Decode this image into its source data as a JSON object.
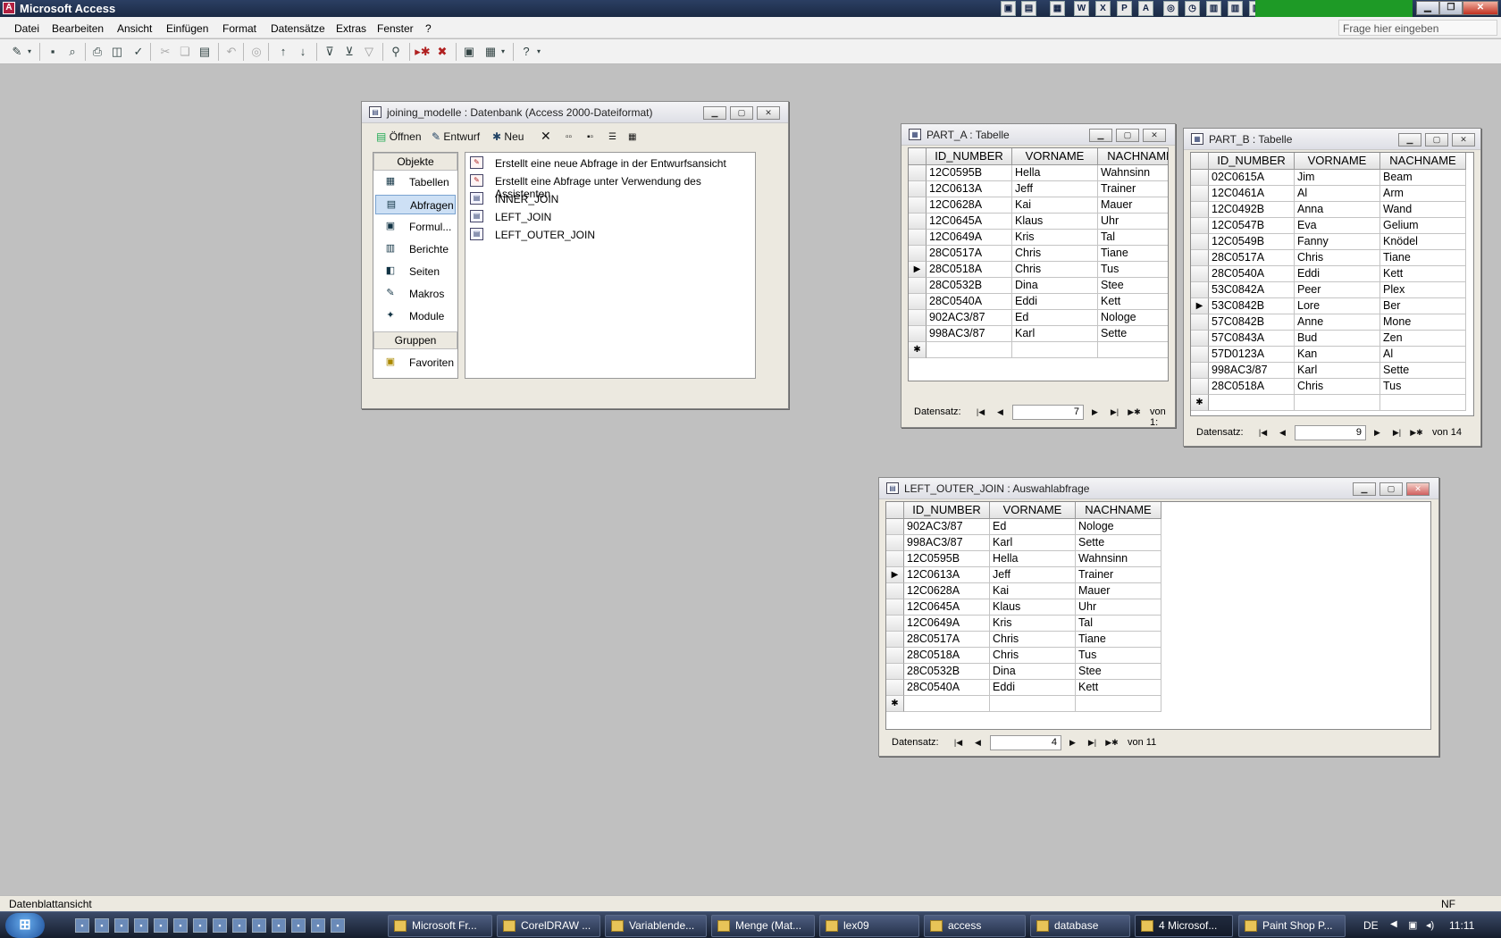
{
  "app": {
    "title": "Microsoft Access"
  },
  "quick_icons": [
    "app-icon",
    "notepad-icon",
    "excel-icon",
    "word-icon",
    "excel-icon",
    "powerpoint-icon",
    "acrobat-icon",
    "network-icon",
    "clock-icon",
    "folder-icon",
    "folder-icon",
    "folder-icon"
  ],
  "menu": {
    "items": [
      "Datei",
      "Bearbeiten",
      "Ansicht",
      "Einfügen",
      "Format",
      "Datensätze",
      "Extras",
      "Fenster",
      "?"
    ],
    "help_box": "Frage hier eingeben"
  },
  "db_window": {
    "title": "joining_modelle : Datenbank (Access 2000-Dateiformat)",
    "toolbar": {
      "open": "Öffnen",
      "design": "Entwurf",
      "new": "Neu"
    },
    "objects_header": "Objekte",
    "objects": [
      {
        "label": "Tabellen",
        "icon": "table-icon",
        "glyph": "▦"
      },
      {
        "label": "Abfragen",
        "icon": "query-icon",
        "glyph": "▤"
      },
      {
        "label": "Formul...",
        "icon": "form-icon",
        "glyph": "▣"
      },
      {
        "label": "Berichte",
        "icon": "report-icon",
        "glyph": "▥"
      },
      {
        "label": "Seiten",
        "icon": "page-icon",
        "glyph": "◧"
      },
      {
        "label": "Makros",
        "icon": "macro-icon",
        "glyph": "✎"
      },
      {
        "label": "Module",
        "icon": "module-icon",
        "glyph": "✦"
      }
    ],
    "groups_header": "Gruppen",
    "favorites": "Favoriten",
    "list": [
      "Erstellt eine neue Abfrage in der Entwurfsansicht",
      "Erstellt eine Abfrage unter Verwendung des Assistenten",
      "INNER_JOIN",
      "LEFT_JOIN",
      "LEFT_OUTER_JOIN"
    ]
  },
  "part_a": {
    "title": "PART_A : Tabelle",
    "columns": [
      "ID_NUMBER",
      "VORNAME",
      "NACHNAME"
    ],
    "rows": [
      [
        "12C0595B",
        "Hella",
        "Wahnsinn"
      ],
      [
        "12C0613A",
        "Jeff",
        "Trainer"
      ],
      [
        "12C0628A",
        "Kai",
        "Mauer"
      ],
      [
        "12C0645A",
        "Klaus",
        "Uhr"
      ],
      [
        "12C0649A",
        "Kris",
        "Tal"
      ],
      [
        "28C0517A",
        "Chris",
        "Tiane"
      ],
      [
        "28C0518A",
        "Chris",
        "Tus"
      ],
      [
        "28C0532B",
        "Dina",
        "Stee"
      ],
      [
        "28C0540A",
        "Eddi",
        "Kett"
      ],
      [
        "902AC3/87",
        "Ed",
        "Nologe"
      ],
      [
        "998AC3/87",
        "Karl",
        "Sette"
      ]
    ],
    "current_row": 6,
    "nav": {
      "label": "Datensatz:",
      "record": "7",
      "of": "von 1:"
    }
  },
  "part_b": {
    "title": "PART_B : Tabelle",
    "columns": [
      "ID_NUMBER",
      "VORNAME",
      "NACHNAME"
    ],
    "rows": [
      [
        "02C0615A",
        "Jim",
        "Beam"
      ],
      [
        "12C0461A",
        "Al",
        "Arm"
      ],
      [
        "12C0492B",
        "Anna",
        "Wand"
      ],
      [
        "12C0547B",
        "Eva",
        "Gelium"
      ],
      [
        "12C0549B",
        "Fanny",
        "Knödel"
      ],
      [
        "28C0517A",
        "Chris",
        "Tiane"
      ],
      [
        "28C0540A",
        "Eddi",
        "Kett"
      ],
      [
        "53C0842A",
        "Peer",
        "Plex"
      ],
      [
        "53C0842B",
        "Lore",
        "Ber"
      ],
      [
        "57C0842B",
        "Anne",
        "Mone"
      ],
      [
        "57C0843A",
        "Bud",
        "Zen"
      ],
      [
        "57D0123A",
        "Kan",
        "Al"
      ],
      [
        "998AC3/87",
        "Karl",
        "Sette"
      ],
      [
        "28C0518A",
        "Chris",
        "Tus"
      ]
    ],
    "current_row": 8,
    "nav": {
      "label": "Datensatz:",
      "record": "9",
      "of": "von 14"
    }
  },
  "query": {
    "title": "LEFT_OUTER_JOIN : Auswahlabfrage",
    "columns": [
      "ID_NUMBER",
      "VORNAME",
      "NACHNAME"
    ],
    "rows": [
      [
        "902AC3/87",
        "Ed",
        "Nologe"
      ],
      [
        "998AC3/87",
        "Karl",
        "Sette"
      ],
      [
        "12C0595B",
        "Hella",
        "Wahnsinn"
      ],
      [
        "12C0613A",
        "Jeff",
        "Trainer"
      ],
      [
        "12C0628A",
        "Kai",
        "Mauer"
      ],
      [
        "12C0645A",
        "Klaus",
        "Uhr"
      ],
      [
        "12C0649A",
        "Kris",
        "Tal"
      ],
      [
        "28C0517A",
        "Chris",
        "Tiane"
      ],
      [
        "28C0518A",
        "Chris",
        "Tus"
      ],
      [
        "28C0532B",
        "Dina",
        "Stee"
      ],
      [
        "28C0540A",
        "Eddi",
        "Kett"
      ]
    ],
    "current_row": 3,
    "nav": {
      "label": "Datensatz:",
      "record": "4",
      "of": "von 11"
    }
  },
  "status": {
    "text": "Datenblattansicht",
    "nf": "NF"
  },
  "taskbar": {
    "tasks": [
      "Microsoft Fr...",
      "CorelDRAW ...",
      "Variablende...",
      "Menge (Mat...",
      "lex09",
      "access",
      "database",
      "4 Microsof...",
      "Paint Shop P..."
    ],
    "active_index": 7,
    "lang": "DE",
    "clock": "11:11"
  },
  "glyphs": {
    "current": "▶",
    "new": "✱",
    "first": "|◀",
    "prev": "◀",
    "next": "▶",
    "last": "▶|",
    "newrec": "▶✱"
  }
}
